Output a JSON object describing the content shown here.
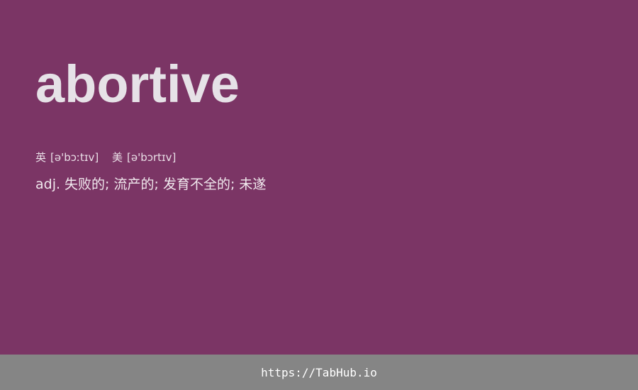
{
  "word": "abortive",
  "phonetics": {
    "uk": {
      "label": "英",
      "ipa": "[ə'bɔːtɪv]"
    },
    "us": {
      "label": "美",
      "ipa": "[ə'bɔrtɪv]"
    }
  },
  "definition": "adj. 失败的; 流产的; 发育不全的; 未遂",
  "footer": {
    "link_text": "https://TabHub.io"
  },
  "colors": {
    "background": "#7b3565",
    "footer": "#858585",
    "word": "#e6e2e7"
  }
}
